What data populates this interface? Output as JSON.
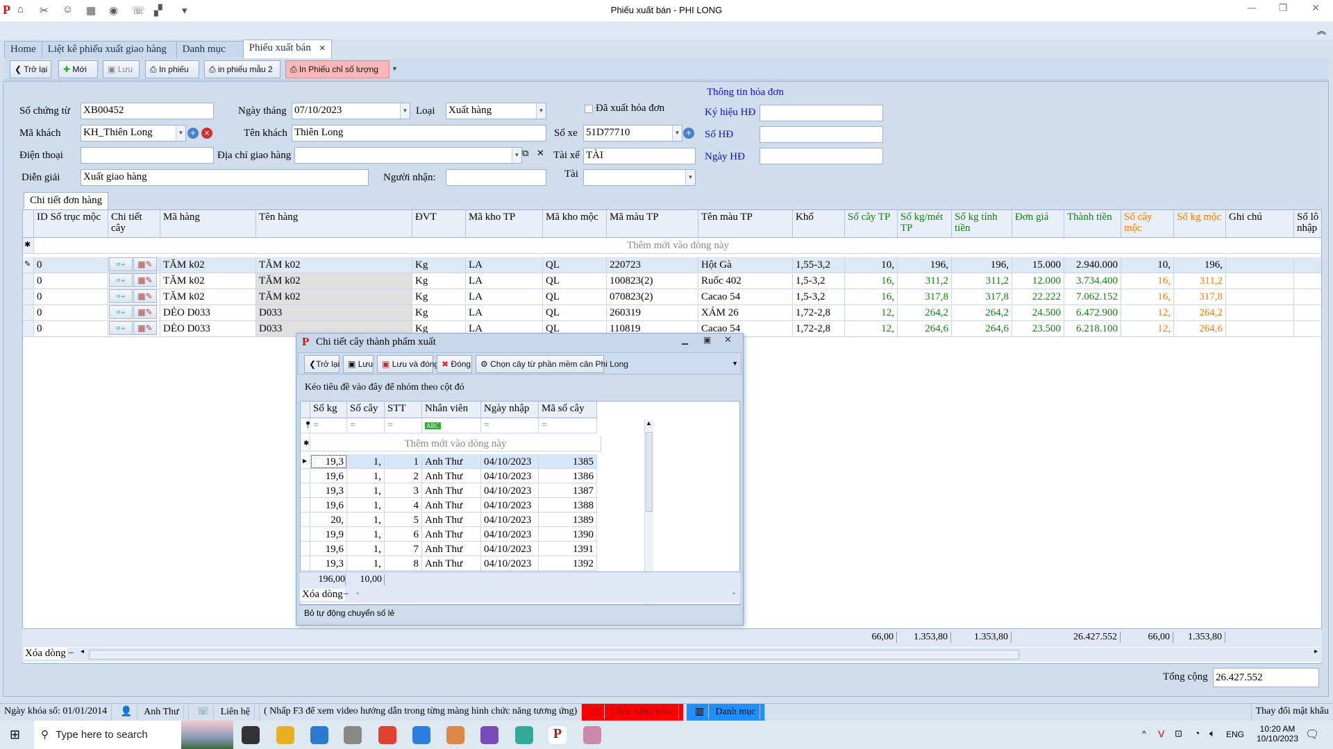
{
  "window": {
    "title": "Phiếu xuất bán - PHI LONG",
    "minimize": "—",
    "restore": "❐",
    "close": "✕",
    "ribbon_collapse": "︽"
  },
  "quick_access": [
    "home-icon",
    "tools-icon",
    "user-icon",
    "film-icon",
    "eye-icon",
    "phone-icon",
    "window-icon",
    "dropdown-icon"
  ],
  "tabs": [
    {
      "label": "Home"
    },
    {
      "label": "Liệt kê phiếu xuất giao hàng"
    },
    {
      "label": "Danh mục"
    },
    {
      "label": "Phiếu xuất bán",
      "close": "✕"
    }
  ],
  "toolbar": {
    "back": "Trở lại",
    "new": "Mới",
    "save": "Lưu",
    "print": "In phiếu",
    "print2": "in phiếu mẫu 2",
    "print_qty": "In Phiếu chỉ số lượng"
  },
  "form": {
    "so_chung_tu": {
      "label": "Số chứng từ",
      "value": "XB00452"
    },
    "ngay_thang": {
      "label": "Ngày tháng",
      "value": "07/10/2023"
    },
    "loai": {
      "label": "Loại",
      "value": "Xuất hàng"
    },
    "da_xuat_hoa_don": {
      "label": "Đã xuất hóa đơn",
      "checked": false
    },
    "ma_khach": {
      "label": "Mã khách",
      "value": "KH_Thiên Long"
    },
    "ten_khach": {
      "label": "Tên khách",
      "value": "Thiên Long"
    },
    "so_xe": {
      "label": "Số xe",
      "value": "51D77710"
    },
    "dien_thoai": {
      "label": "Điện thoại",
      "value": ""
    },
    "dia_chi": {
      "label": "Địa chỉ giao hàng",
      "value": ""
    },
    "tai_xe": {
      "label": "Tài xế",
      "value": "TÀI"
    },
    "dien_giai": {
      "label": "Diễn giải",
      "value": "Xuất giao hàng"
    },
    "nguoi_nhan": {
      "label": "Người nhận:",
      "value": ""
    },
    "tai": {
      "label": "Tài",
      "value": ""
    }
  },
  "invoice": {
    "title": "Thông tin hóa đơn",
    "ky_hieu": {
      "label": "Ký hiệu HĐ",
      "value": ""
    },
    "so_hd": {
      "label": "Số HĐ",
      "value": ""
    },
    "ngay_hd": {
      "label": "Ngày HĐ",
      "value": ""
    },
    "color": "#1010d0"
  },
  "detail_tab": "Chi tiết đơn hàng",
  "grid": {
    "columns": [
      "ID Số trục mộc",
      "Chi tiết cây",
      "Mã hàng",
      "Tên hàng",
      "ĐVT",
      "Mã kho TP",
      "Mã kho mộc",
      "Mã màu TP",
      "Tên màu TP",
      "Khổ",
      "Số cây TP",
      "Số kg/mét TP",
      "Số kg tính tiền",
      "Đơn giá",
      "Thành tiền",
      "Số cây mộc",
      "Số kg mộc",
      "Ghi chú",
      "Số lô nhập"
    ],
    "new_row": "Thêm mới vào dòng này",
    "rows": [
      [
        "0",
        "",
        "TĂM k02",
        "TĂM k02",
        "Kg",
        "LA",
        "QL",
        "220723",
        "Hột Gà",
        "1,55-3,2",
        "10,",
        "196,",
        "196,",
        "15.000",
        "2.940.000",
        "10,",
        "196,",
        "",
        ""
      ],
      [
        "0",
        "",
        "TĂM k02",
        "TĂM k02",
        "Kg",
        "LA",
        "QL",
        "100823(2)",
        "Ruốc 402",
        "1,5-3,2",
        "16,",
        "311,2",
        "311,2",
        "12.000",
        "3.734.400",
        "16,",
        "311,2",
        "",
        ""
      ],
      [
        "0",
        "",
        "TĂM k02",
        "TĂM k02",
        "Kg",
        "LA",
        "QL",
        "070823(2)",
        "Cacao 54",
        "1,5-3,2",
        "16,",
        "317,8",
        "317,8",
        "22.222",
        "7.062.152",
        "16,",
        "317,8",
        "",
        ""
      ],
      [
        "0",
        "",
        "DẺO D033",
        "D033",
        "Kg",
        "LA",
        "QL",
        "260319",
        "XÁM 26",
        "1,72-2,8",
        "12,",
        "264,2",
        "264,2",
        "24.500",
        "6.472.900",
        "12,",
        "264,2",
        "",
        ""
      ],
      [
        "0",
        "",
        "DẺO D033",
        "D033",
        "Kg",
        "LA",
        "QL",
        "110819",
        "Cacao 54",
        "1,72-2,8",
        "12,",
        "264,6",
        "264,6",
        "23.500",
        "6.218.100",
        "12,",
        "264,6",
        "",
        ""
      ]
    ],
    "totals": {
      "so_cay_tp": "66,00",
      "so_kg_met": "1.353,80",
      "so_kg_tinh_tien": "1.353,80",
      "thanh_tien": "26.427.552",
      "so_cay_moc": "66,00",
      "so_kg_moc": "1.353,80"
    },
    "delete_row": "Xóa dòng",
    "colors": {
      "green": "#108010",
      "orange": "#ff7a00"
    }
  },
  "tong_cong": {
    "label": "Tổng cộng",
    "value": "26.427.552"
  },
  "dialog": {
    "title": "Chi tiết cây  thành phẩm xuất",
    "toolbar": {
      "back": "Trở lại",
      "save": "Lưu",
      "save_close": "Lưu và đóng",
      "close": "Đóng",
      "choose": "Chọn cây từ phần mềm cân Phi Long"
    },
    "group_hint": "Kéo tiêu đề vào đây để nhóm theo cột đó",
    "columns": [
      "Số kg",
      "Số cây",
      "STT",
      "Nhân viên",
      "Ngày nhập",
      "Mã số cây"
    ],
    "filter": [
      "=",
      "=",
      "=",
      "ABC",
      "=",
      "="
    ],
    "new_row": "Thêm mới vào dòng này",
    "rows": [
      [
        "19,3",
        "1,",
        "1",
        "Anh Thư",
        "04/10/2023",
        "1385"
      ],
      [
        "19,6",
        "1,",
        "2",
        "Anh Thư",
        "04/10/2023",
        "1386"
      ],
      [
        "19,3",
        "1,",
        "3",
        "Anh Thư",
        "04/10/2023",
        "1387"
      ],
      [
        "19,6",
        "1,",
        "4",
        "Anh Thư",
        "04/10/2023",
        "1388"
      ],
      [
        "20,",
        "1,",
        "5",
        "Anh Thư",
        "04/10/2023",
        "1389"
      ],
      [
        "19,9",
        "1,",
        "6",
        "Anh Thư",
        "04/10/2023",
        "1390"
      ],
      [
        "19,6",
        "1,",
        "7",
        "Anh Thư",
        "04/10/2023",
        "1391"
      ],
      [
        "19,3",
        "1,",
        "8",
        "Anh Thư",
        "04/10/2023",
        "1392"
      ]
    ],
    "totals": [
      "196,00",
      "10,00"
    ],
    "delete_row": "Xóa dòng",
    "status": "Bỏ tự động chuyển số lẻ"
  },
  "statusbar": {
    "lock_date": "Ngày khóa sổ: 01/01/2014",
    "user": "Anh Thư",
    "contact": "Liên hệ",
    "hint": "( Nhấp F3 để xem video hướng dẫn trong từng màng hình chức năng tương ứng)",
    "other": "Chức năng khác",
    "catalog": "Danh mục",
    "change_password": "Thay đổi mật khẩu",
    "other_color": "#ff0000",
    "catalog_color": "#1e90ff"
  },
  "taskbar": {
    "search_placeholder": "Type here to search",
    "lang": "ENG",
    "time": "10:20 AM",
    "date": "10/10/2023",
    "apps": [
      "task-view",
      "file-explorer",
      "teamviewer",
      "tool",
      "chrome",
      "zalo",
      "chrome-alt",
      "visual-studio",
      "app",
      "phi-long",
      "paint"
    ]
  }
}
